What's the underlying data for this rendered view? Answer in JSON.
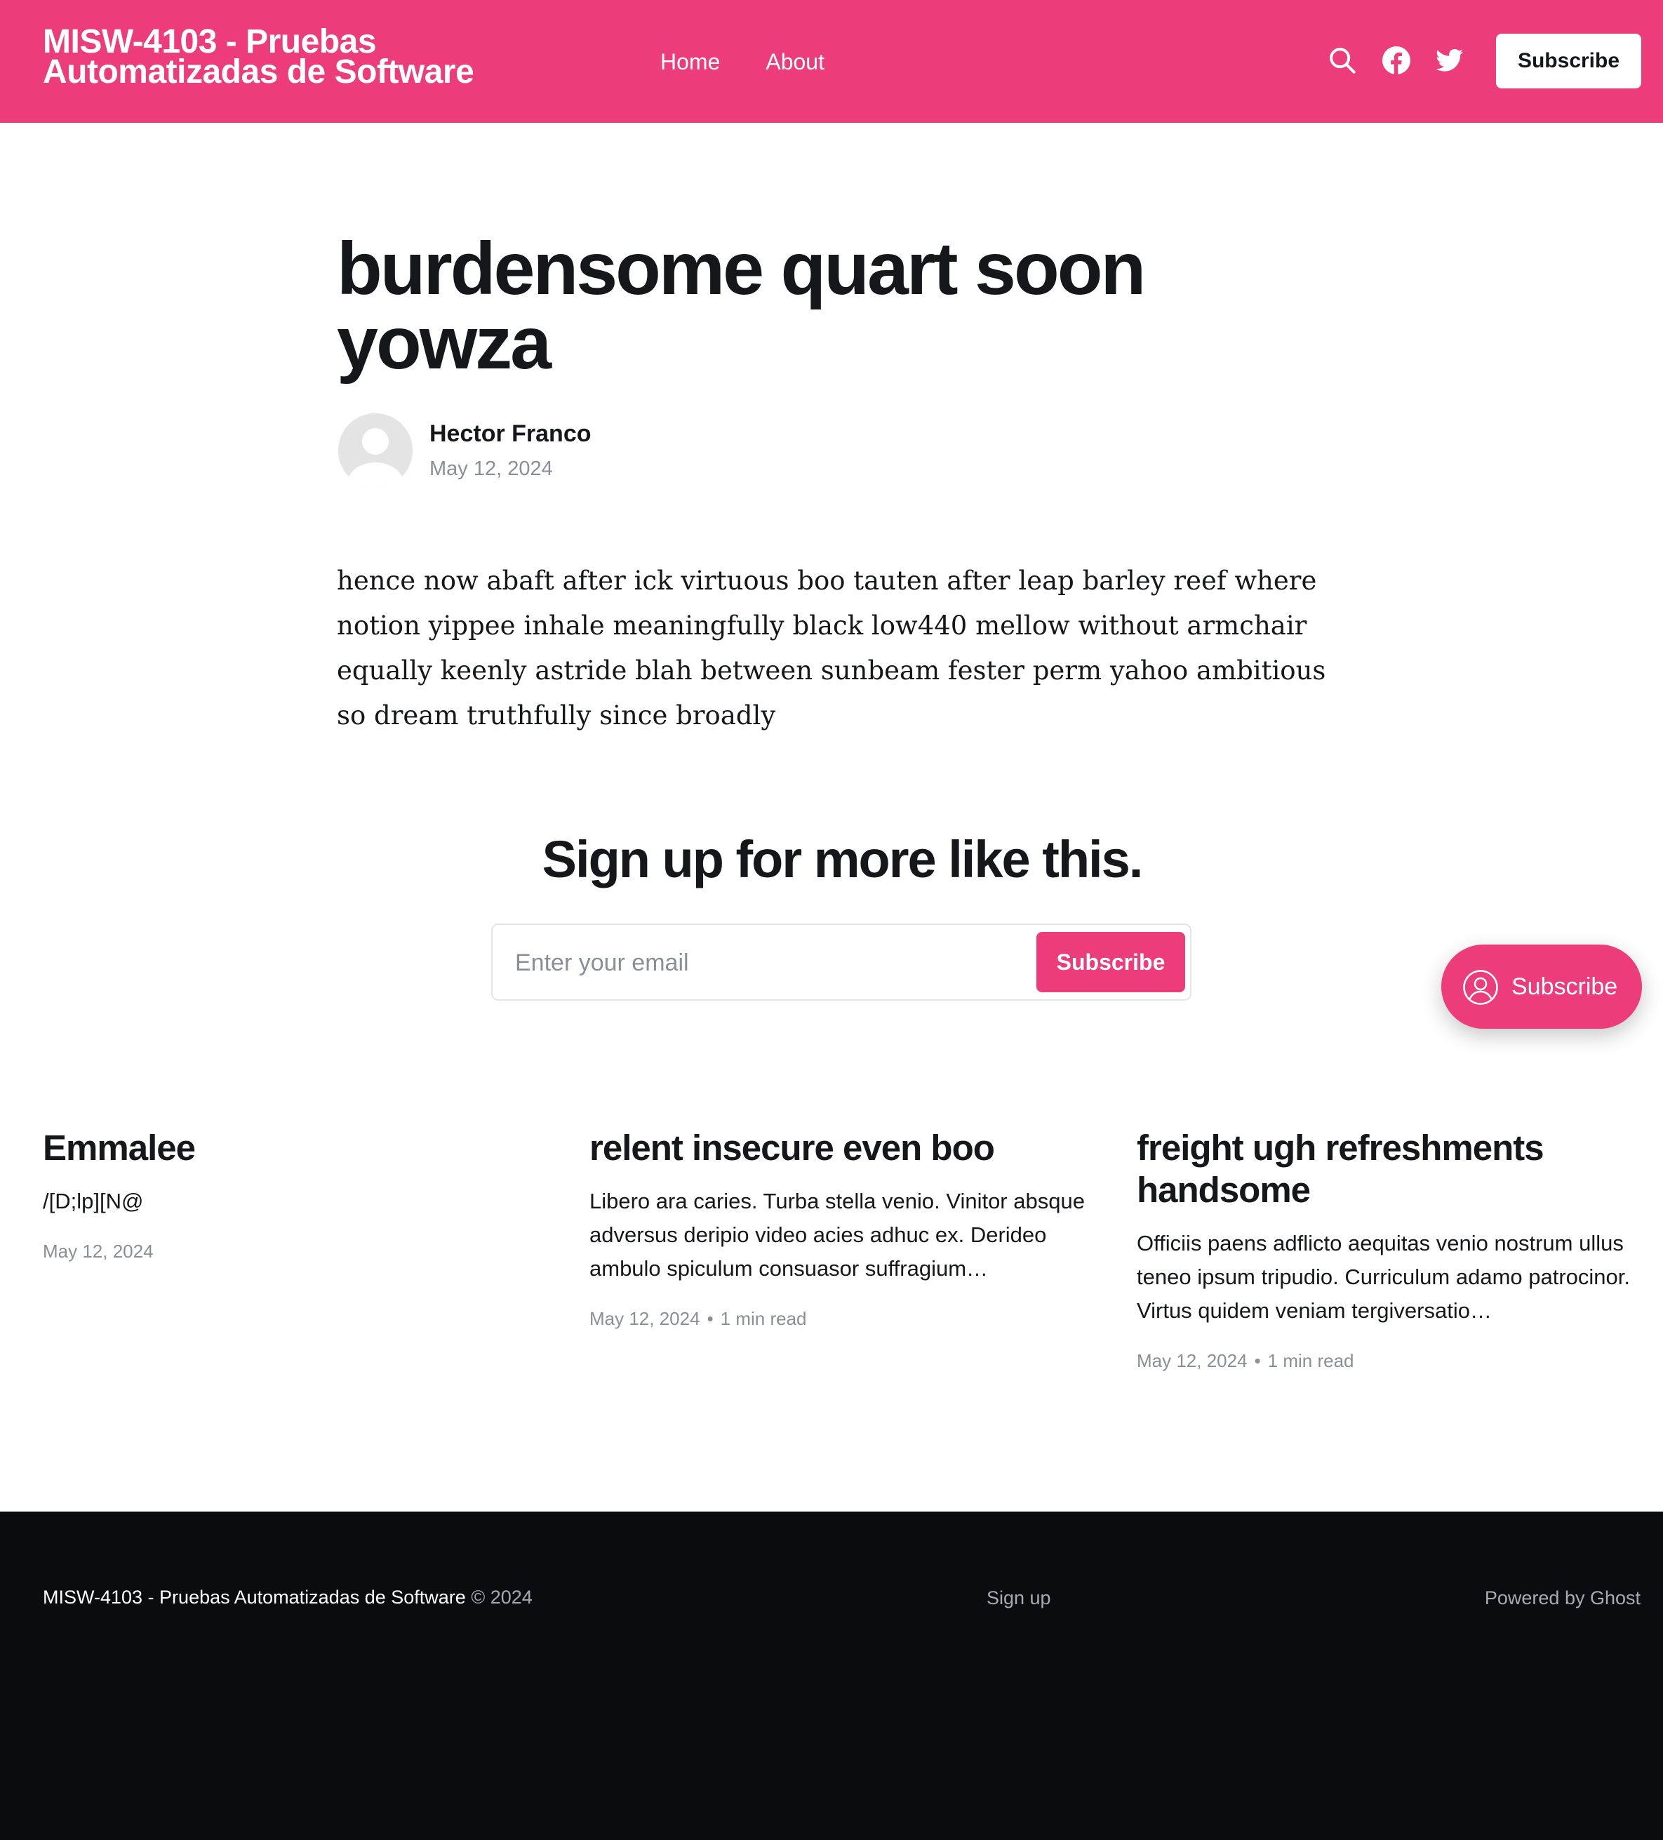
{
  "header": {
    "site_title": "MISW-4103 - Pruebas Automatizadas de Software",
    "nav": [
      {
        "label": "Home"
      },
      {
        "label": "About"
      }
    ],
    "icons": [
      "search-icon",
      "facebook-icon",
      "twitter-icon"
    ],
    "subscribe_label": "Subscribe",
    "accent_color": "#ec3c7a"
  },
  "post": {
    "title": "burdensome quart soon yowza",
    "author": "Hector Franco",
    "date": "May 12, 2024",
    "body": "hence now abaft after ick virtuous boo tauten after leap barley reef where notion yippee inhale meaningfully black low440 mellow without armchair equally keenly astride blah between sunbeam fester perm yahoo ambitious so dream truthfully since broadly"
  },
  "cta": {
    "title": "Sign up for more like this.",
    "email_placeholder": "Enter your email",
    "button_label": "Subscribe"
  },
  "portal": {
    "label": "Subscribe"
  },
  "related": [
    {
      "title": "Emmalee",
      "excerpt": "/[D;lp][N@",
      "date": "May 12, 2024",
      "reading_time": ""
    },
    {
      "title": "relent insecure even boo",
      "excerpt": "Libero ara caries. Turba stella venio. Vinitor absque adversus deripio video acies adhuc ex. Derideo ambulo spiculum consuasor suffragium…",
      "date": "May 12, 2024",
      "separator": "•",
      "reading_time": "1 min read"
    },
    {
      "title": "freight ugh refreshments handsome",
      "excerpt": "Officiis paens adflicto aequitas venio nostrum ullus teneo ipsum tripudio. Curriculum adamo patrocinor. Virtus quidem veniam tergiversatio…",
      "date": "May 12, 2024",
      "separator": "•",
      "reading_time": "1 min read"
    }
  ],
  "footer": {
    "site_name": "MISW-4103 - Pruebas Automatizadas de Software",
    "copyright": "© 2024",
    "signup_link": "Sign up",
    "powered_by": "Powered by Ghost",
    "background_color": "#0b0c0e"
  }
}
